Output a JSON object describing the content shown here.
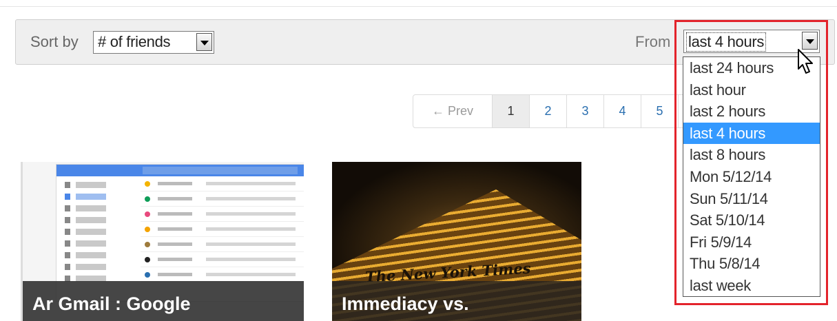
{
  "toolbar": {
    "sort_label": "Sort by",
    "sort_value": "# of friends",
    "from_label": "From",
    "from_value": "last 4 hours"
  },
  "pagination": {
    "prev": "← Prev",
    "pages": [
      "1",
      "2",
      "3",
      "4",
      "5"
    ],
    "current": "1"
  },
  "dropdown": {
    "options": [
      "last 24 hours",
      "last hour",
      "last 2 hours",
      "last 4 hours",
      "last 8 hours",
      "Mon 5/12/14",
      "Sun 5/11/14",
      "Sat 5/10/14",
      "Fri 5/9/14",
      "Thu 5/8/14",
      "last week"
    ],
    "selected": "last 4 hours"
  },
  "cards": [
    {
      "title": "Ar Gmail : Google"
    },
    {
      "title": "Immediacy vs.",
      "sign_text": "The New York Times"
    }
  ],
  "colors": {
    "highlight": "#e3232b",
    "selected_option": "#3399ff",
    "link": "#2a6fb0"
  }
}
